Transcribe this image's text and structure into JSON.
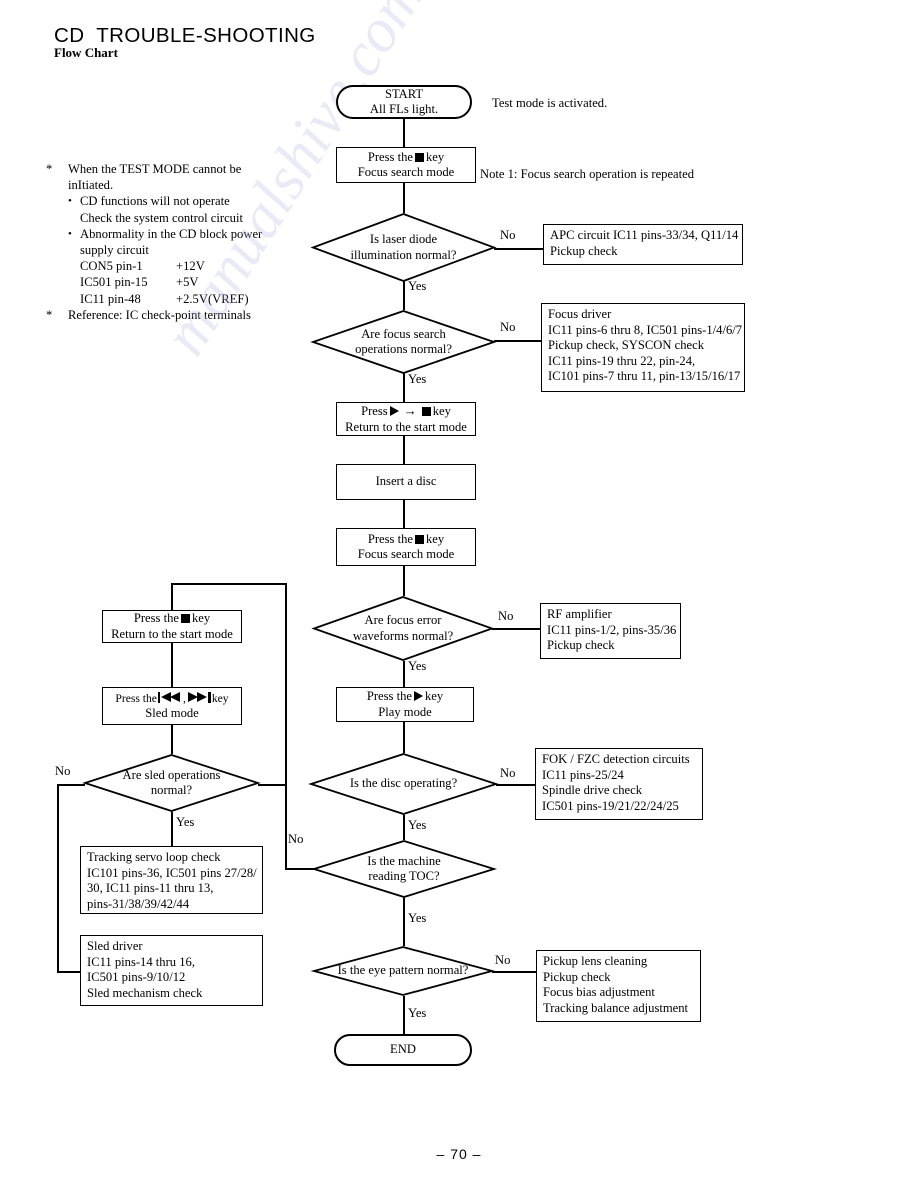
{
  "document": {
    "title": "CD  TROUBLE-SHOOTING",
    "subtitle": "Flow Chart",
    "page_number": "– 70 –",
    "watermark": "manualshive.com"
  },
  "notes": {
    "note1_star": "*",
    "note1_line1": "When the TEST  MODE cannot be",
    "note1_line2": "inItiated.",
    "bullet1_line1": "CD functions will not operate",
    "bullet1_line2": "Check the system control circuit",
    "bullet2_line1": "Abnormality in the CD block power",
    "bullet2_line2": "supply circuit",
    "pins": [
      {
        "name": "CON5 pin-1",
        "value": "+12V"
      },
      {
        "name": "IC501 pin-15",
        "value": "+5V"
      },
      {
        "name": "IC11 pin-48",
        "value": "+2.5V(VREF)"
      }
    ],
    "note2_star": "*",
    "note2_text": "Reference: IC check-point terminals"
  },
  "annotations": {
    "test_mode": "Test mode is activated.",
    "note1": "Note 1: Focus search operation is repeated"
  },
  "edge_labels": {
    "no": "No",
    "yes": "Yes"
  },
  "flow": {
    "start": {
      "line1": "START",
      "line2": "All FLs light."
    },
    "press_stop_focus_1": {
      "line1_pre": "Press the",
      "line1_post": "key",
      "line2": "Focus search mode"
    },
    "decision_laser": {
      "line1": "Is laser diode",
      "line2": "illumination normal?"
    },
    "box_apc": {
      "lines": [
        "APC circuit IC11 pins-33/34, Q11/14",
        "Pickup check"
      ]
    },
    "decision_focus_search": {
      "line1": "Are focus search",
      "line2": "operations normal?"
    },
    "box_focus_driver": {
      "lines": [
        "Focus driver",
        "IC11 pins-6 thru 8, IC501 pins-1/4/6/7",
        "Pickup check, SYSCON check",
        "IC11 pins-19 thru 22, pin-24,",
        "IC101 pins-7 thru 11, pin-13/15/16/17"
      ]
    },
    "press_play_stop": {
      "line1_pre": "Press",
      "line1_post": "key",
      "line2": "Return to the start mode"
    },
    "insert_disc": {
      "line1": "Insert a disc"
    },
    "press_stop_focus_2": {
      "line1_pre": "Press the",
      "line1_post": "key",
      "line2": "Focus search mode"
    },
    "decision_focus_error": {
      "line1": "Are focus error",
      "line2": "waveforms normal?"
    },
    "box_rf_amp": {
      "lines": [
        "RF amplifier",
        "IC11 pins-1/2, pins-35/36",
        "Pickup check"
      ]
    },
    "press_stop_return": {
      "line1_pre": "Press the",
      "line1_post": "key",
      "line2": "Return to the start mode"
    },
    "press_sled": {
      "line1_pre": "Press the",
      "line1_mid": ",",
      "line1_post": "key",
      "line2": "Sled mode"
    },
    "decision_sled": {
      "line1": "Are sled operations",
      "line2": "normal?"
    },
    "box_tracking_servo": {
      "lines": [
        "Tracking servo loop check",
        "IC101 pins-36, IC501 pins 27/28/",
        "30, IC11 pins-11 thru 13,",
        "pins-31/38/39/42/44"
      ]
    },
    "box_sled_driver": {
      "lines": [
        "Sled driver",
        "IC11 pins-14 thru 16,",
        "IC501 pins-9/10/12",
        "Sled mechanism check"
      ]
    },
    "press_play": {
      "line1_pre": "Press the",
      "line1_post": "key",
      "line2": "Play mode"
    },
    "decision_disc_operating": {
      "line1": "Is the disc operating?"
    },
    "box_fok_fzc": {
      "lines": [
        "FOK / FZC detection circuits",
        "IC11 pins-25/24",
        "Spindle drive check",
        "IC501 pins-19/21/22/24/25"
      ]
    },
    "decision_toc": {
      "line1": "Is the machine",
      "line2": "reading TOC?"
    },
    "decision_eye_pattern": {
      "line1": "Is the eye pattern normal?"
    },
    "box_pickup_lens": {
      "lines": [
        "Pickup lens cleaning",
        "Pickup check",
        "Focus bias adjustment",
        "Tracking balance adjustment"
      ]
    },
    "end": {
      "line1": "END"
    }
  }
}
